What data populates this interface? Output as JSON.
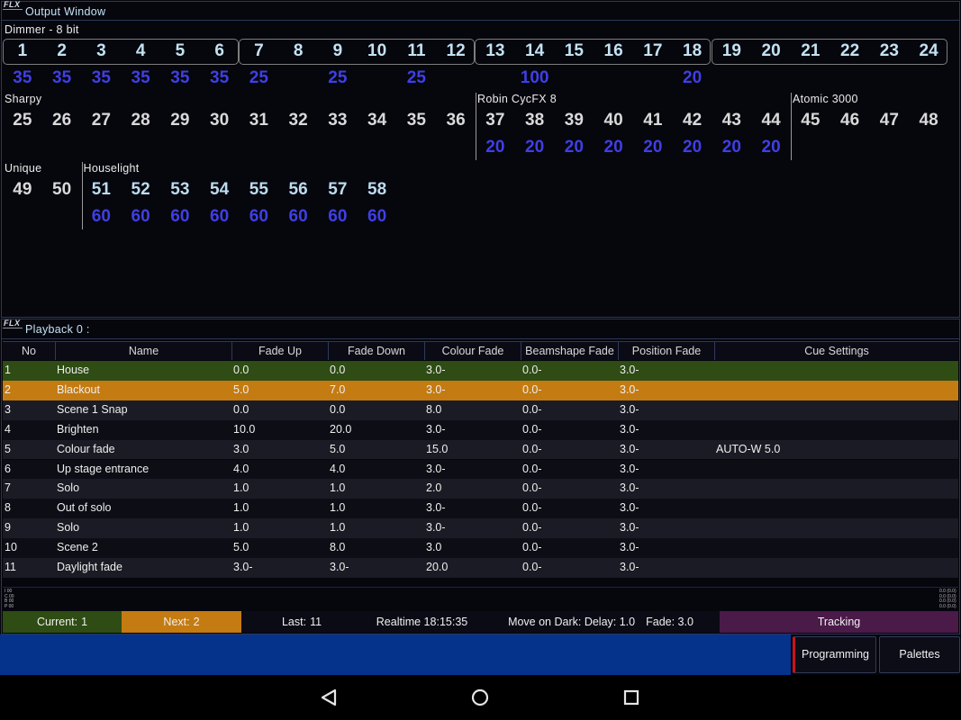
{
  "output_window": {
    "logo": "FLX",
    "title": "Output Window",
    "groups": [
      {
        "name": "Dimmer - 8 bit",
        "number_color": "#c3e2f3",
        "channels": [
          {
            "num": "1",
            "level": "35"
          },
          {
            "num": "2",
            "level": "35"
          },
          {
            "num": "3",
            "level": "35"
          },
          {
            "num": "4",
            "level": "35"
          },
          {
            "num": "5",
            "level": "35"
          },
          {
            "num": "6",
            "level": "35"
          },
          {
            "num": "7",
            "level": "25"
          },
          {
            "num": "8"
          },
          {
            "num": "9",
            "level": "25"
          },
          {
            "num": "10"
          },
          {
            "num": "11",
            "level": "25"
          },
          {
            "num": "12"
          },
          {
            "num": "13"
          },
          {
            "num": "14",
            "level": "100"
          },
          {
            "num": "15"
          },
          {
            "num": "16"
          },
          {
            "num": "17"
          },
          {
            "num": "18",
            "level": "20"
          },
          {
            "num": "19"
          },
          {
            "num": "20"
          },
          {
            "num": "21"
          },
          {
            "num": "22"
          },
          {
            "num": "23"
          },
          {
            "num": "24"
          }
        ]
      },
      {
        "name": "Sharpy",
        "number_color": "#d9d9d9",
        "channels": [
          {
            "num": "25"
          },
          {
            "num": "26"
          },
          {
            "num": "27"
          },
          {
            "num": "28"
          },
          {
            "num": "29"
          },
          {
            "num": "30"
          },
          {
            "num": "31"
          },
          {
            "num": "32"
          },
          {
            "num": "33"
          },
          {
            "num": "34"
          },
          {
            "num": "35"
          },
          {
            "num": "36"
          }
        ]
      },
      {
        "name": "Robin CycFX 8",
        "number_color": "#d9d9d9",
        "channels": [
          {
            "num": "37",
            "level": "20"
          },
          {
            "num": "38",
            "level": "20"
          },
          {
            "num": "39",
            "level": "20"
          },
          {
            "num": "40",
            "level": "20"
          },
          {
            "num": "41",
            "level": "20"
          },
          {
            "num": "42",
            "level": "20"
          },
          {
            "num": "43",
            "level": "20"
          },
          {
            "num": "44",
            "level": "20"
          }
        ]
      },
      {
        "name": "Atomic 3000",
        "number_color": "#d9d9d9",
        "channels": [
          {
            "num": "45"
          },
          {
            "num": "46"
          },
          {
            "num": "47"
          },
          {
            "num": "48"
          }
        ]
      },
      {
        "name": "Unique",
        "number_color": "#d9d9d9",
        "channels": [
          {
            "num": "49"
          },
          {
            "num": "50"
          }
        ]
      },
      {
        "name": "Houselight",
        "number_color": "#bcdcef",
        "channels": [
          {
            "num": "51",
            "level": "60"
          },
          {
            "num": "52",
            "level": "60"
          },
          {
            "num": "53",
            "level": "60"
          },
          {
            "num": "54",
            "level": "60"
          },
          {
            "num": "55",
            "level": "60"
          },
          {
            "num": "56",
            "level": "60"
          },
          {
            "num": "57",
            "level": "60"
          },
          {
            "num": "58",
            "level": "60"
          }
        ]
      }
    ]
  },
  "playback": {
    "logo": "FLX",
    "title": "Playback 0 :",
    "columns": [
      "No",
      "Name",
      "Fade Up",
      "Fade Down",
      "Colour Fade",
      "Beamshape Fade",
      "Position Fade",
      "Cue Settings"
    ],
    "cues": [
      {
        "no": "1",
        "name": "House",
        "fade_up": "0.0",
        "fade_down": "0.0",
        "colour_fade": "3.0-",
        "beamshape_fade": "0.0-",
        "position_fade": "3.0-",
        "cue_settings": ""
      },
      {
        "no": "2",
        "name": "Blackout",
        "fade_up": "5.0",
        "fade_down": "7.0",
        "colour_fade": "3.0-",
        "beamshape_fade": "0.0-",
        "position_fade": "3.0-",
        "cue_settings": ""
      },
      {
        "no": "3",
        "name": "Scene 1 Snap",
        "fade_up": "0.0",
        "fade_down": "0.0",
        "colour_fade": "8.0",
        "beamshape_fade": "0.0-",
        "position_fade": "3.0-",
        "cue_settings": ""
      },
      {
        "no": "4",
        "name": "Brighten",
        "fade_up": "10.0",
        "fade_down": "20.0",
        "colour_fade": "3.0-",
        "beamshape_fade": "0.0-",
        "position_fade": "3.0-",
        "cue_settings": ""
      },
      {
        "no": "5",
        "name": "Colour fade",
        "fade_up": "3.0",
        "fade_down": "5.0",
        "colour_fade": "15.0",
        "beamshape_fade": "0.0-",
        "position_fade": "3.0-",
        "cue_settings": "AUTO-W 5.0"
      },
      {
        "no": "6",
        "name": "Up stage entrance",
        "fade_up": "4.0",
        "fade_down": "4.0",
        "colour_fade": "3.0-",
        "beamshape_fade": "0.0-",
        "position_fade": "3.0-",
        "cue_settings": ""
      },
      {
        "no": "7",
        "name": "Solo",
        "fade_up": "1.0",
        "fade_down": "1.0",
        "colour_fade": "2.0",
        "beamshape_fade": "0.0-",
        "position_fade": "3.0-",
        "cue_settings": ""
      },
      {
        "no": "8",
        "name": "Out of solo",
        "fade_up": "1.0",
        "fade_down": "1.0",
        "colour_fade": "3.0-",
        "beamshape_fade": "0.0-",
        "position_fade": "3.0-",
        "cue_settings": ""
      },
      {
        "no": "9",
        "name": "Solo",
        "fade_up": "1.0",
        "fade_down": "1.0",
        "colour_fade": "3.0-",
        "beamshape_fade": "0.0-",
        "position_fade": "3.0-",
        "cue_settings": ""
      },
      {
        "no": "10",
        "name": "Scene 2",
        "fade_up": "5.0",
        "fade_down": "8.0",
        "colour_fade": "3.0",
        "beamshape_fade": "0.0-",
        "position_fade": "3.0-",
        "cue_settings": ""
      },
      {
        "no": "11",
        "name": "Daylight fade",
        "fade_up": "3.0-",
        "fade_down": "3.0-",
        "colour_fade": "20.0",
        "beamshape_fade": "0.0-",
        "position_fade": "3.0-",
        "cue_settings": ""
      }
    ],
    "indicators_left": [
      "I 00",
      "C 00",
      "B 00",
      "P 00"
    ],
    "indicators_right": [
      "0.0 (0.0)",
      "0.0 (0.0)",
      "0.0 (0.0)",
      "0.0 (0.0)"
    ]
  },
  "status_bar": {
    "current_label": "Current:",
    "current_value": "1",
    "next_label": "Next:",
    "next_value": "2",
    "last_label": "Last:",
    "last_value": "11",
    "realtime": "Realtime 18:15:35",
    "move_on_dark": "Move on Dark: Delay: 1.0",
    "move_on_dark_fade": "Fade: 3.0",
    "mode": "Tracking"
  },
  "soft_buttons": {
    "programming": "Programming",
    "palettes": "Palettes"
  },
  "nav_bar": {
    "back_icon": "back-icon",
    "home_icon": "home-icon",
    "recents_icon": "recents-icon"
  },
  "colors": {
    "current_cue": "#2e4c13",
    "next_cue": "#c47b12",
    "tracking": "#4a1a49",
    "channel_level": "#3f3fe6",
    "command_bar": "#05338c",
    "programming_accent": "#c8141e"
  }
}
